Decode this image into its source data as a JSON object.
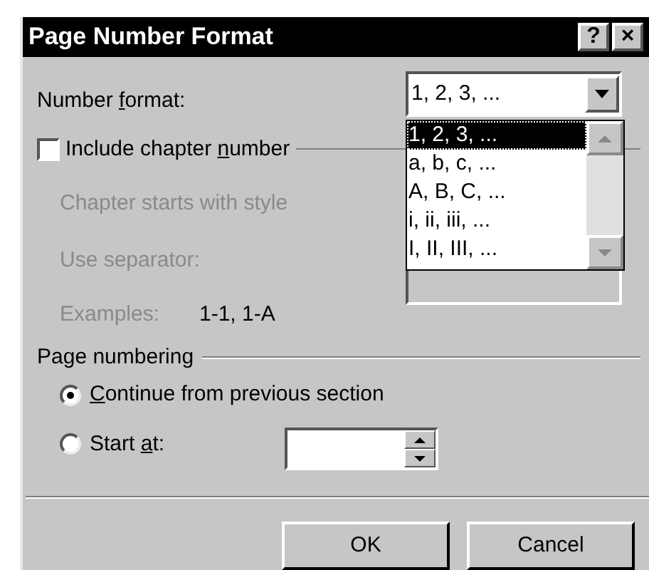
{
  "window": {
    "title": "Page Number Format",
    "buttons": [
      "?",
      "×"
    ]
  },
  "number_format": {
    "label": {
      "before": "Number ",
      "accel": "f",
      "after": "ormat:"
    },
    "value": "1, 2, 3, ...",
    "expanded": true,
    "options": [
      {
        "label": "1, 2, 3, ...",
        "selected": true
      },
      {
        "label": "a, b, c, ...",
        "selected": false
      },
      {
        "label": "A, B, C, ...",
        "selected": false
      },
      {
        "label": "i, ii, iii, ...",
        "selected": false
      },
      {
        "label": "I, II, III, ...",
        "selected": false
      }
    ]
  },
  "include_chapter": {
    "label": {
      "before": "Include chapter ",
      "accel": "n",
      "after": "umber"
    },
    "checked": false
  },
  "chapter_style": {
    "label": "Chapter starts with style",
    "disabled": true
  },
  "separator": {
    "label": "Use separator:",
    "disabled": true
  },
  "examples": {
    "label": "Examples:",
    "value": "1-1, 1-A",
    "disabled": true
  },
  "page_numbering": {
    "title": "Page numbering",
    "options": [
      {
        "label": {
          "accel": "C",
          "after": "ontinue from previous section"
        },
        "selected": true
      },
      {
        "label": {
          "before": "Start ",
          "accel": "a",
          "after": "t:"
        },
        "selected": false
      }
    ]
  },
  "buttons": [
    "OK",
    "Cancel"
  ]
}
